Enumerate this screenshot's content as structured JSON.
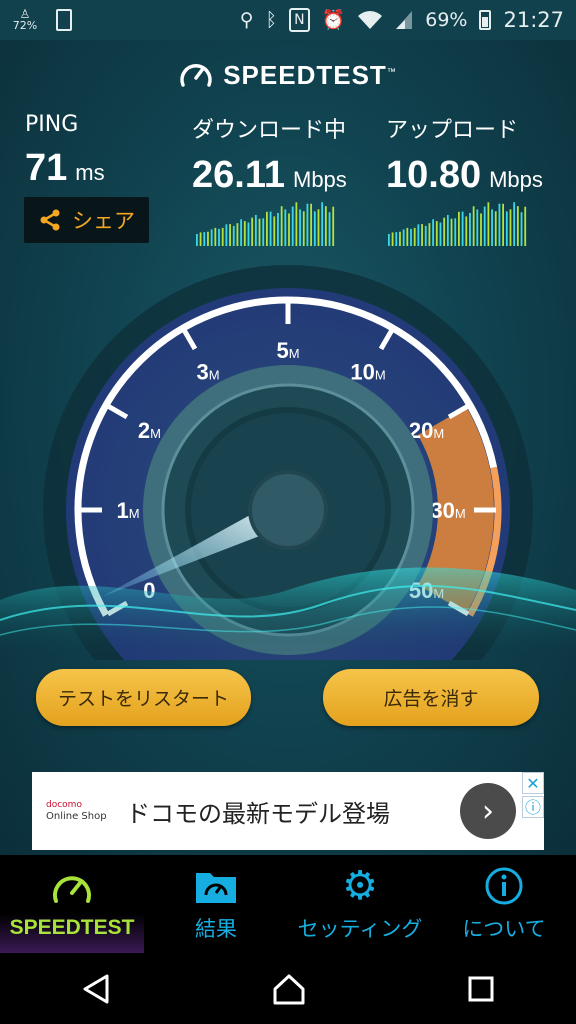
{
  "status_bar": {
    "left_battery": "72%",
    "signal_percent": "69%",
    "time": "21:27"
  },
  "logo": {
    "text": "SPEEDTEST",
    "tm": "™"
  },
  "metrics": {
    "ping": {
      "label": "PING",
      "value": "71",
      "unit": "ms"
    },
    "download": {
      "label": "ダウンロード中",
      "value": "26.11",
      "unit": "Mbps"
    },
    "upload": {
      "label": "アップロード",
      "value": "10.80",
      "unit": "Mbps"
    }
  },
  "share": {
    "label": "シェア"
  },
  "gauge": {
    "ticks": [
      "0",
      "1",
      "2",
      "3",
      "5",
      "10",
      "20",
      "30",
      "50"
    ],
    "tick_suffix": "M",
    "current_mbps": 26.11
  },
  "buttons": {
    "restart": "テストをリスタート",
    "remove_ads": "広告を消す"
  },
  "ad": {
    "brand_line1": "docomo",
    "brand_line2": "Online Shop",
    "text": "ドコモの最新モデル登場"
  },
  "tabs": [
    {
      "label": "SPEEDTEST",
      "icon": "speedometer-icon"
    },
    {
      "label": "結果",
      "icon": "results-folder-icon"
    },
    {
      "label": "セッティング",
      "icon": "gear-icon"
    },
    {
      "label": "について",
      "icon": "info-icon"
    }
  ],
  "colors": {
    "accent_green": "#a8e23a",
    "tab_blue": "#16aee0",
    "share_orange": "#f5a623",
    "gauge_purple": "#7b4bd6",
    "gauge_orange": "#f08a2a"
  }
}
